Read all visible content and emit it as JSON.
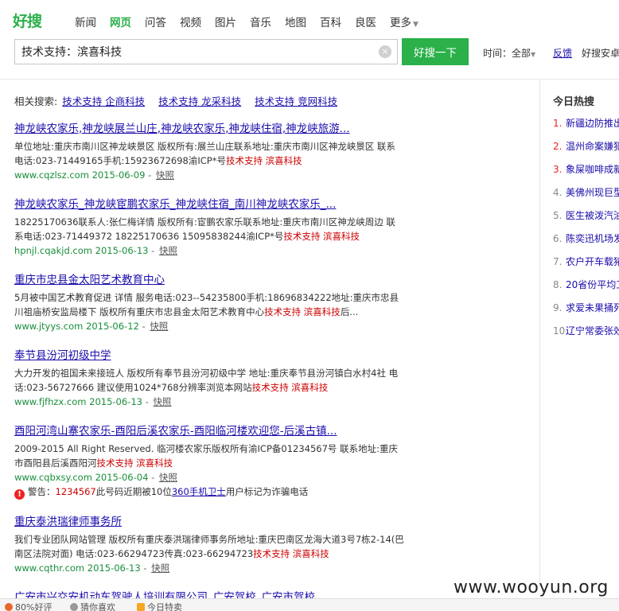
{
  "logo": {
    "text": "好搜"
  },
  "nav": [
    {
      "label": "新闻",
      "active": false
    },
    {
      "label": "网页",
      "active": true
    },
    {
      "label": "问答",
      "active": false
    },
    {
      "label": "视频",
      "active": false
    },
    {
      "label": "图片",
      "active": false
    },
    {
      "label": "音乐",
      "active": false
    },
    {
      "label": "地图",
      "active": false
    },
    {
      "label": "百科",
      "active": false
    },
    {
      "label": "良医",
      "active": false
    },
    {
      "label": "更多",
      "active": false
    }
  ],
  "search": {
    "value": "技术支持：滨喜科技",
    "button_label": "好搜一下"
  },
  "toolbar": {
    "time_label": "时间：全部",
    "feedback_label": "反馈",
    "ext_label": "好搜安卓"
  },
  "related": {
    "label": "相关搜索:",
    "items": [
      "技术支持 企商科技",
      "技术支持 龙采科技",
      "技术支持 竞网科技"
    ]
  },
  "results": [
    {
      "title": "神龙峡农家乐,神龙峡展兰山庄,神龙峡农家乐,神龙峡住宿,神龙峡旅游...",
      "snippet": "单位地址:重庆市南川区神龙峡景区 版权所有:展兰山庄联系地址:重庆市南川区神龙峡景区 联系电话:023-71449165手机:15923672698渝ICP*号",
      "highlight": "技术支持 滨喜科技",
      "url": "www.cqzlsz.com",
      "date": "2015-06-09",
      "snapshot": "快照"
    },
    {
      "title": "神龙峡农家乐_神龙峡宦鹏农家乐_神龙峡住宿_南川神龙峡农家乐_...",
      "snippet": "18225170636联系人:张仁梅详情 版权所有:宦鹏农家乐联系地址:重庆市南川区神龙峡周边 联系电话:023-71449372 18225170636 15095838244渝ICP*号",
      "highlight": "技术支持 滨喜科技",
      "url": "hpnjl.cqakjd.com",
      "date": "2015-06-13",
      "snapshot": "快照"
    },
    {
      "title": "重庆市忠县金太阳艺术教育中心",
      "snippet": "5月被中国艺术教育促进 详情 服务电话:023--54235800手机:18696834222地址:重庆市忠县川祖庙桥安监局楼下 版权所有重庆市忠县金太阳艺术教育中心",
      "highlight": "技术支持 滨喜科技",
      "tail": "后...",
      "url": "www.jtyys.com",
      "date": "2015-06-12",
      "snapshot": "快照"
    },
    {
      "title": "奉节县汾河初级中学",
      "snippet": "大力开发的祖国未来接班人 版权所有奉节县汾河初级中学 地址:重庆奉节县汾河镇白水村4社 电话:023-56727666 建议使用1024*768分辨率浏览本网站",
      "highlight": "技术支持 滨喜科技",
      "url": "www.fjfhzx.com",
      "date": "2015-06-13",
      "snapshot": "快照"
    },
    {
      "title": "酉阳河湾山寨农家乐-酉阳后溪农家乐-酉阳临河楼欢迎您-后溪古镇...",
      "snippet": "2009-2015 All Right Reserved. 临河楼农家乐版权所有渝ICP备01234567号 联系地址:重庆市酉阳县后溪酉阳河",
      "highlight": "技术支持 滨喜科技",
      "url": "www.cqbxsy.com",
      "date": "2015-06-04",
      "snapshot": "快照",
      "warning": {
        "prefix": "警告：",
        "phone": "1234567",
        "middle": "此号码近期被10位",
        "link": "360手机卫士",
        "suffix": "用户标记为诈骗电话"
      }
    },
    {
      "title": "重庆泰洪瑞律师事务所",
      "snippet": "我们专业团队网站管理 版权所有重庆泰洪瑞律师事务所地址:重庆巴南区龙海大道3号7栋2-14(巴南区法院对面) 电话:023-66294723传真:023-66294723",
      "highlight": "技术支持 滨喜科技",
      "url": "www.cqthr.com",
      "date": "2015-06-13",
      "snapshot": "快照"
    },
    {
      "title": "广安市兴交安机动车驾驶人培训有限公司_广安驾校_广安市驾校",
      "snippet": "",
      "highlight": "",
      "url": "",
      "date": "",
      "snapshot": ""
    }
  ],
  "hot": {
    "title": "今日热搜",
    "items": [
      "新疆边防推出",
      "温州命案嫌犯",
      "象屎咖啡成新",
      "美佛州现巨型",
      "医生被泼汽油",
      "陈奕迅机场发",
      "农户开车载猪",
      "20省份平均工",
      "求爱未果捅死",
      "辽宁常委张效"
    ]
  },
  "bottom_bar": [
    "80%好评",
    "猜你喜欢",
    "今日特卖"
  ],
  "watermark": "www.wooyun.org",
  "colors": {
    "brand": "#2bb04a",
    "link": "#1a0dab",
    "highlight": "#cc0000",
    "url": "#198e3a"
  }
}
